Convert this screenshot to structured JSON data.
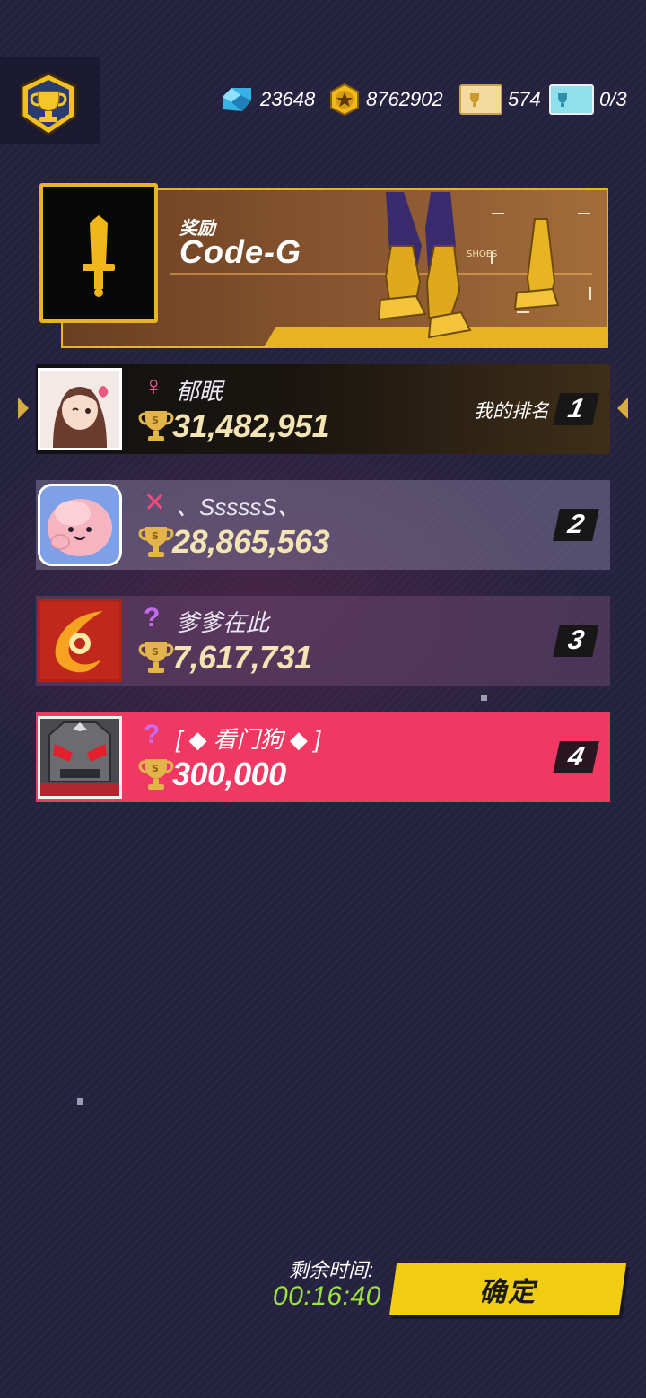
{
  "header": {
    "currencies": [
      {
        "icon": "gem-icon",
        "amount": "23648",
        "color": "#3fb7e6"
      },
      {
        "icon": "gold-coin-icon",
        "amount": "8762902",
        "color": "#e8b51f"
      },
      {
        "icon": "gold-ticket-icon",
        "amount": "574",
        "color": "#e9cf8f"
      },
      {
        "icon": "blue-ticket-icon",
        "amount": "0/3",
        "color": "#7fd8e6"
      }
    ]
  },
  "reward": {
    "label": "奖励",
    "name": "Code-G",
    "icon": "sword-icon"
  },
  "rankings": [
    {
      "rank": "1",
      "name": "郁眠",
      "score": "31,482,951",
      "symbol": "♀",
      "my_rank_label": "我的排名"
    },
    {
      "rank": "2",
      "name": "、SssssS、",
      "score": "28,865,563",
      "symbol": "✕"
    },
    {
      "rank": "3",
      "name": "爹爹在此",
      "score": "7,617,731",
      "symbol": "?"
    },
    {
      "rank": "4",
      "name": "[ ◆ 看门狗 ◆ ]",
      "score": "300,000",
      "symbol": "?"
    }
  ],
  "footer": {
    "time_label": "剩余时间:",
    "time_value": "00:16:40",
    "confirm_label": "确定"
  },
  "colors": {
    "background": "#24223f",
    "accent_gold": "#e5b523",
    "highlight_row": "#ef3862",
    "timer_green": "#9de33a",
    "button_yellow": "#f0cd13"
  }
}
